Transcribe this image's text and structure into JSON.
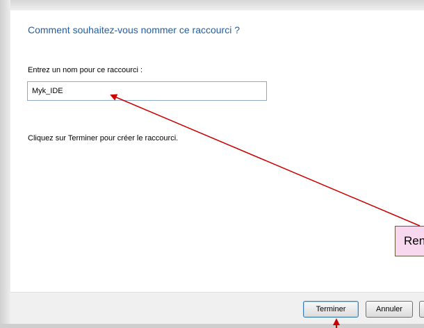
{
  "dialog": {
    "heading": "Comment souhaitez-vous nommer ce raccourci ?",
    "field_label": "Entrez un nom pour ce raccourci :",
    "name_value": "Myk_IDE",
    "hint": "Cliquez sur Terminer pour créer le raccourci."
  },
  "buttons": {
    "finish": "Terminer",
    "cancel": "Annuler"
  },
  "annotation": {
    "callout_text": "Ren",
    "arrow_color": "#cc0000",
    "callout_color": "#f8d8ee"
  },
  "colors": {
    "heading": "#1e5fa8",
    "footer": "#f0f0f0"
  }
}
